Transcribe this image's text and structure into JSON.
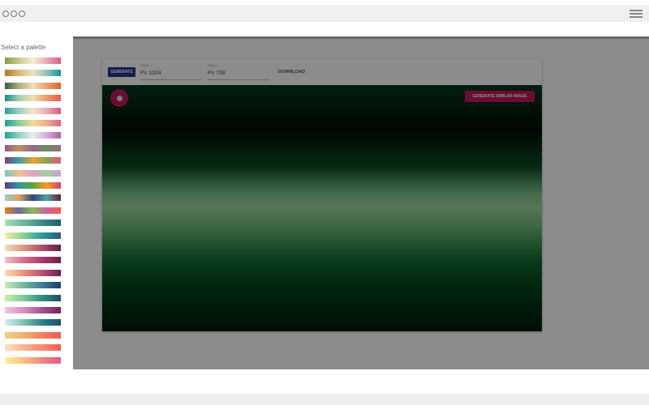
{
  "sidebar": {
    "title": "Select a palette",
    "palettes": [
      [
        "#8a9a4a",
        "#c9c98a",
        "#f6eed8",
        "#e9a7b6",
        "#d75f86"
      ],
      [
        "#b07a2c",
        "#d8b878",
        "#ece4c0",
        "#8ec4be",
        "#1a8f96"
      ],
      [
        "#3e5b3a",
        "#a9b080",
        "#efe1b4",
        "#eda070",
        "#d8622c"
      ],
      [
        "#1e8a84",
        "#a6cdb4",
        "#f0dfb0",
        "#ec9a6e",
        "#e0604a"
      ],
      [
        "#26a0a0",
        "#9ccdc0",
        "#f2e6d0",
        "#eeaab6",
        "#d8587e"
      ],
      [
        "#20a09a",
        "#8ccc9a",
        "#ecdc98",
        "#ecae8a",
        "#dc6486"
      ],
      [
        "#20a090",
        "#8cd0c4",
        "#ececec",
        "#d0aedc",
        "#b0609c"
      ],
      [
        "#8a5c8a",
        "#c09060",
        "#8a6a8a",
        "#6e8a5e",
        "#9a6a80"
      ],
      [
        "#7a3a8a",
        "#3aa0a0",
        "#f0a030",
        "#8aa050",
        "#e05a80"
      ],
      [
        "#70c8c0",
        "#f0c090",
        "#e0a0c0",
        "#a0d0a0",
        "#d0a0d0"
      ],
      [
        "#5a3a8a",
        "#2a9a9a",
        "#60a040",
        "#f0a020",
        "#d04080"
      ],
      [
        "#90d0d0",
        "#e0a060",
        "#2a4a7a",
        "#50a0a0",
        "#6a1a3a"
      ],
      [
        "#e88020",
        "#6a6a9a",
        "#8aba50",
        "#d060a0",
        "#f06050"
      ],
      [
        "#a8e0b0",
        "#6ab898",
        "#3a8a88",
        "#1e5e6c"
      ],
      [
        "#f8f0a0",
        "#8ad090",
        "#2a9a9a",
        "#2a5a7a"
      ],
      [
        "#f0dcc0",
        "#d89a80",
        "#a8506a",
        "#5e1e3e"
      ],
      [
        "#f0c0c8",
        "#d8708e",
        "#a83a6a",
        "#6e1e48"
      ],
      [
        "#f8dcb0",
        "#f09080",
        "#c05070",
        "#5e2050"
      ],
      [
        "#c8f0b8",
        "#70b8a0",
        "#3a7e96",
        "#1e3e6c"
      ],
      [
        "#c8f0a8",
        "#80c898",
        "#2e8a80",
        "#1e4e60"
      ],
      [
        "#f0c8e0",
        "#d890c0",
        "#a8508e",
        "#6e2458"
      ],
      [
        "#d8f0e8",
        "#80c0b8",
        "#2e7e88",
        "#1e4e68"
      ],
      [
        "#f0d080",
        "#f0b070",
        "#f08060",
        "#f05a50"
      ],
      [
        "#fce0c0",
        "#f8b890",
        "#f88870",
        "#f25a50"
      ],
      [
        "#fcf0a0",
        "#f8c080",
        "#f08880",
        "#e05888"
      ]
    ]
  },
  "toolbar": {
    "generate": "GENERATE",
    "width_label": "Width",
    "width_value": "Px  1024",
    "height_label": "Height",
    "height_value": "Px  768",
    "download": "DOWNLOAD"
  },
  "canvas": {
    "similar": "GENERATE SIMILAR IMAGE"
  }
}
